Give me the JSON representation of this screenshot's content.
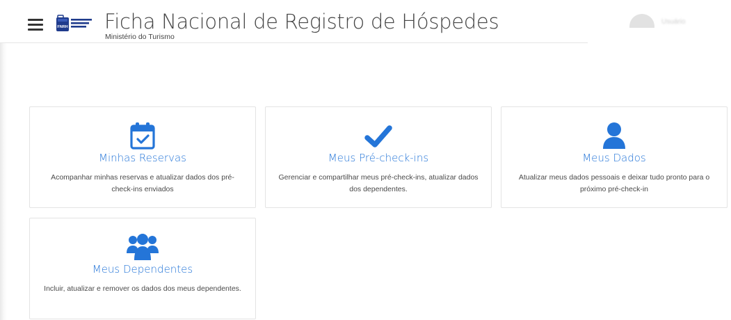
{
  "header": {
    "title": "Ficha Nacional de Registro de Hóspedes",
    "subtitle": "Ministério do Turismo",
    "logo_text": "FICHA NACIONAL DE REGISTRO DE HÓSPEDES",
    "logo_badge": "FNRH",
    "user_name": "Usuário"
  },
  "cards": [
    {
      "title": "Minhas Reservas",
      "description": "Acompanhar minhas reservas e atualizar dados dos pré-check-ins enviados",
      "icon": "calendar-check-icon"
    },
    {
      "title": "Meus Pré-check-ins",
      "description": "Gerenciar e compartilhar meus pré-check-ins, atualizar dados dos dependentes.",
      "icon": "check-icon"
    },
    {
      "title": "Meus Dados",
      "description": "Atualizar meus dados pessoais e deixar tudo pronto para o próximo pré-check-in",
      "icon": "user-icon"
    },
    {
      "title": "Meus Dependentes",
      "description": "Incluir, atualizar e remover os dados dos meus dependentes.",
      "icon": "users-icon"
    }
  ],
  "colors": {
    "accent": "#2475d8",
    "text": "#4a4a4a",
    "border": "#e3e3e3"
  }
}
